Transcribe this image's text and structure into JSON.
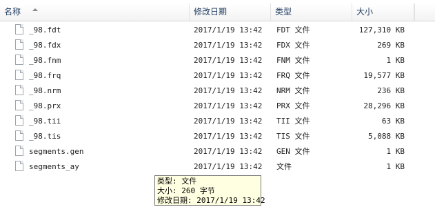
{
  "columns": {
    "name": "名称",
    "date": "修改日期",
    "type": "类型",
    "size": "大小"
  },
  "files": [
    {
      "name": "_98.fdt",
      "date": "2017/1/19 13:42",
      "type": "FDT 文件",
      "size": "127,310 KB"
    },
    {
      "name": "_98.fdx",
      "date": "2017/1/19 13:42",
      "type": "FDX 文件",
      "size": "269 KB"
    },
    {
      "name": "_98.fnm",
      "date": "2017/1/19 13:42",
      "type": "FNM 文件",
      "size": "1 KB"
    },
    {
      "name": "_98.frq",
      "date": "2017/1/19 13:42",
      "type": "FRQ 文件",
      "size": "19,577 KB"
    },
    {
      "name": "_98.nrm",
      "date": "2017/1/19 13:42",
      "type": "NRM 文件",
      "size": "236 KB"
    },
    {
      "name": "_98.prx",
      "date": "2017/1/19 13:42",
      "type": "PRX 文件",
      "size": "28,296 KB"
    },
    {
      "name": "_98.tii",
      "date": "2017/1/19 13:42",
      "type": "TII 文件",
      "size": "63 KB"
    },
    {
      "name": "_98.tis",
      "date": "2017/1/19 13:42",
      "type": "TIS 文件",
      "size": "5,088 KB"
    },
    {
      "name": "segments.gen",
      "date": "2017/1/19 13:42",
      "type": "GEN 文件",
      "size": "1 KB"
    },
    {
      "name": "segments_ay",
      "date": "2017/1/19 13:42",
      "type": "文件",
      "size": "1 KB"
    }
  ],
  "tooltip": {
    "line1": "类型: 文件",
    "line2": "大小: 260 字节",
    "line3": "修改日期: 2017/1/19 13:42"
  }
}
